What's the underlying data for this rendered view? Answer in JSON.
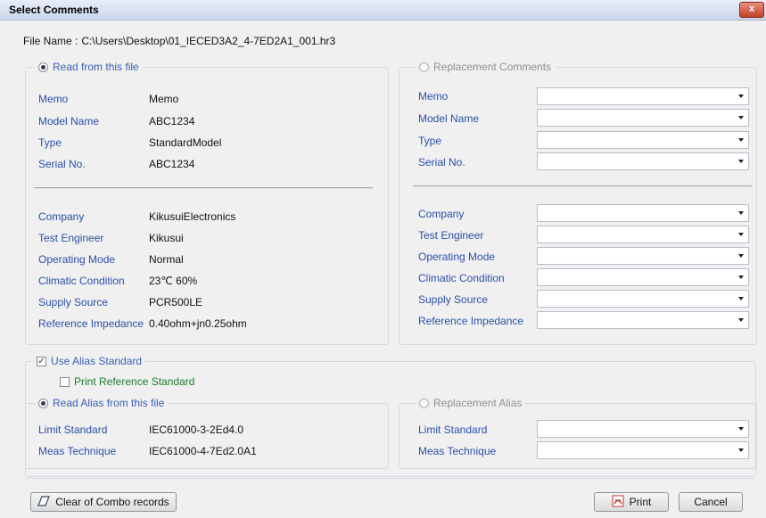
{
  "window": {
    "title": "Select Comments",
    "close_label": "x"
  },
  "file": {
    "label": "File Name :",
    "path": "C:\\Users\\Desktop\\01_IECED3A2_4-7ED2A1_001.hr3"
  },
  "read_group": {
    "legend": "Read from this file",
    "fields_top": [
      {
        "label": "Memo",
        "value": "Memo"
      },
      {
        "label": "Model Name",
        "value": "ABC1234"
      },
      {
        "label": "Type",
        "value": "StandardModel"
      },
      {
        "label": "Serial No.",
        "value": "ABC1234"
      }
    ],
    "fields_bottom": [
      {
        "label": "Company",
        "value": "KikusuiElectronics"
      },
      {
        "label": "Test Engineer",
        "value": "Kikusui"
      },
      {
        "label": "Operating Mode",
        "value": "Normal"
      },
      {
        "label": "Climatic Condition",
        "value": "23℃ 60%"
      },
      {
        "label": "Supply Source",
        "value": "PCR500LE"
      },
      {
        "label": "Reference Impedance",
        "value": "0.40ohm+jn0.25ohm"
      }
    ]
  },
  "replace_group": {
    "legend": "Replacement Comments",
    "fields_top": [
      "Memo",
      "Model Name",
      "Type",
      "Serial No."
    ],
    "fields_bottom": [
      "Company",
      "Test Engineer",
      "Operating Mode",
      "Climatic Condition",
      "Supply Source",
      "Reference Impedance"
    ]
  },
  "alias": {
    "use_label": "Use Alias Standard",
    "use_checked": true,
    "print_ref_label": "Print Reference Standard",
    "print_ref_checked": false,
    "read_legend": "Read Alias from this file",
    "read_fields": [
      {
        "label": "Limit Standard",
        "value": "IEC61000-3-2Ed4.0"
      },
      {
        "label": "Meas Technique",
        "value": "IEC61000-4-7Ed2.0A1"
      }
    ],
    "replace_legend": "Replacement Alias",
    "replace_fields": [
      "Limit Standard",
      "Meas Technique"
    ]
  },
  "buttons": {
    "clear": "Clear of Combo records",
    "print": "Print",
    "cancel": "Cancel"
  },
  "colors": {
    "label_blue": "#2b4fa8",
    "legend_blue": "#3b60b5",
    "close_red": "#c3402a"
  }
}
